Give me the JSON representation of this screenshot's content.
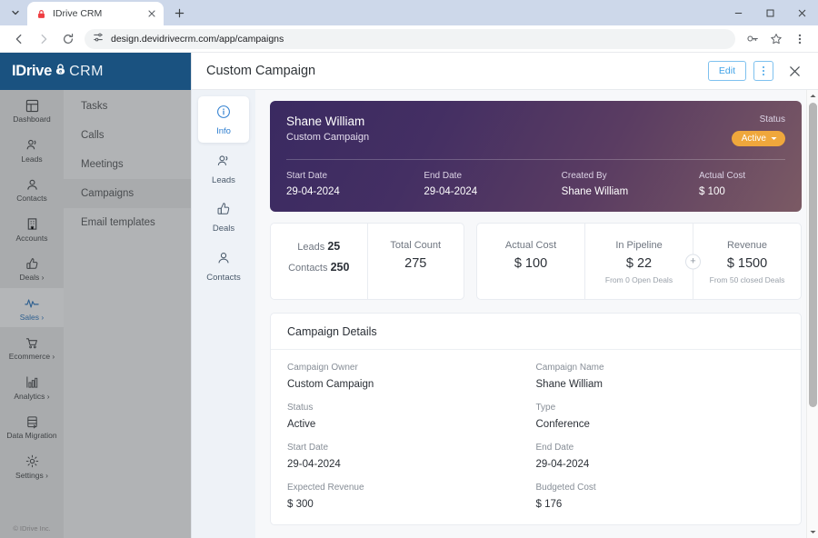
{
  "browser": {
    "tab": {
      "title": "IDrive CRM",
      "favicon_icon": "lock-red-icon",
      "close_icon": "close-icon"
    },
    "tab_list_icon": "chevron-down-icon",
    "new_tab_icon": "plus-icon",
    "window": {
      "minimize": "minimize-icon",
      "maximize": "maximize-icon",
      "close": "close-icon"
    },
    "nav": {
      "back_icon": "arrow-left-icon",
      "forward_icon": "arrow-right-icon",
      "reload_icon": "reload-icon"
    },
    "omnibox": {
      "site_settings_icon": "tune-icon",
      "url": "design.devidrivecrm.com/app/campaigns"
    },
    "toolbar_right": {
      "password_icon": "key-icon",
      "bookmark_icon": "star-icon",
      "menu_icon": "kebab-menu-icon"
    }
  },
  "app": {
    "logo": {
      "main": "IDrive",
      "suffix": "CRM"
    },
    "copyright": "© IDrive Inc.",
    "nav": [
      {
        "label": "Dashboard",
        "icon": "dashboard-icon",
        "active": false,
        "caret": false
      },
      {
        "label": "Leads",
        "icon": "leads-icon",
        "active": false,
        "caret": false
      },
      {
        "label": "Contacts",
        "icon": "contact-icon",
        "active": false,
        "caret": false
      },
      {
        "label": "Accounts",
        "icon": "building-icon",
        "active": false,
        "caret": false
      },
      {
        "label": "Deals",
        "icon": "thumbs-up-icon",
        "active": false,
        "caret": true
      },
      {
        "label": "Sales",
        "icon": "pulse-icon",
        "active": true,
        "caret": true
      },
      {
        "label": "Ecommerce",
        "icon": "cart-icon",
        "active": false,
        "caret": true
      },
      {
        "label": "Analytics",
        "icon": "bar-chart-icon",
        "active": false,
        "caret": true
      },
      {
        "label": "Data Migration",
        "icon": "database-icon",
        "active": false,
        "caret": false
      },
      {
        "label": "Settings",
        "icon": "gear-icon",
        "active": false,
        "caret": true
      }
    ],
    "submenu": [
      {
        "label": "Tasks",
        "active": false
      },
      {
        "label": "Calls",
        "active": false
      },
      {
        "label": "Meetings",
        "active": false
      },
      {
        "label": "Campaigns",
        "active": true
      },
      {
        "label": "Email templates",
        "active": false
      }
    ]
  },
  "detail": {
    "title": "Custom Campaign",
    "edit_label": "Edit",
    "kebab_icon": "kebab-menu-icon",
    "close_icon": "close-icon",
    "tabs": [
      {
        "label": "Info",
        "icon": "info-circle-icon",
        "active": true
      },
      {
        "label": "Leads",
        "icon": "leads-icon",
        "active": false
      },
      {
        "label": "Deals",
        "icon": "thumbs-up-icon",
        "active": false
      },
      {
        "label": "Contacts",
        "icon": "contact-icon",
        "active": false
      }
    ],
    "hero": {
      "name": "Shane William",
      "subtitle": "Custom Campaign",
      "status_label": "Status",
      "status_value": "Active",
      "status_caret_icon": "caret-down-icon",
      "fields": [
        {
          "label": "Start Date",
          "value": "29-04-2024"
        },
        {
          "label": "End Date",
          "value": "29-04-2024"
        },
        {
          "label": "Created By",
          "value": "Shane William"
        },
        {
          "label": "Actual Cost",
          "value": "$ 100"
        }
      ]
    },
    "stats": {
      "leads_label": "Leads",
      "leads_value": "25",
      "contacts_label": "Contacts",
      "contacts_value": "250",
      "total_count_label": "Total Count",
      "total_count_value": "275",
      "actual_cost_label": "Actual Cost",
      "actual_cost_value": "$ 100",
      "pipeline_label": "In Pipeline",
      "pipeline_value": "$ 22",
      "pipeline_note": "From 0 Open Deals",
      "revenue_label": "Revenue",
      "revenue_value": "$ 1500",
      "revenue_note": "From 50 closed Deals",
      "plus_icon": "plus-icon"
    },
    "details_card": {
      "heading": "Campaign Details",
      "rows": [
        [
          {
            "label": "Campaign Owner",
            "value": "Custom Campaign"
          },
          {
            "label": "Campaign Name",
            "value": "Shane William"
          }
        ],
        [
          {
            "label": "Status",
            "value": "Active"
          },
          {
            "label": "Type",
            "value": "Conference"
          }
        ],
        [
          {
            "label": "Start Date",
            "value": "29-04-2024"
          },
          {
            "label": "End Date",
            "value": "29-04-2024"
          }
        ],
        [
          {
            "label": "Expected Revenue",
            "value": "$ 300"
          },
          {
            "label": "Budgeted Cost",
            "value": "$ 176"
          }
        ]
      ]
    }
  },
  "colors": {
    "brand_blue": "#1a5280",
    "accent_blue": "#3fa2e8",
    "status_orange": "#efa73c",
    "hero_from": "#3a2a61",
    "hero_to": "#7b5a64"
  }
}
